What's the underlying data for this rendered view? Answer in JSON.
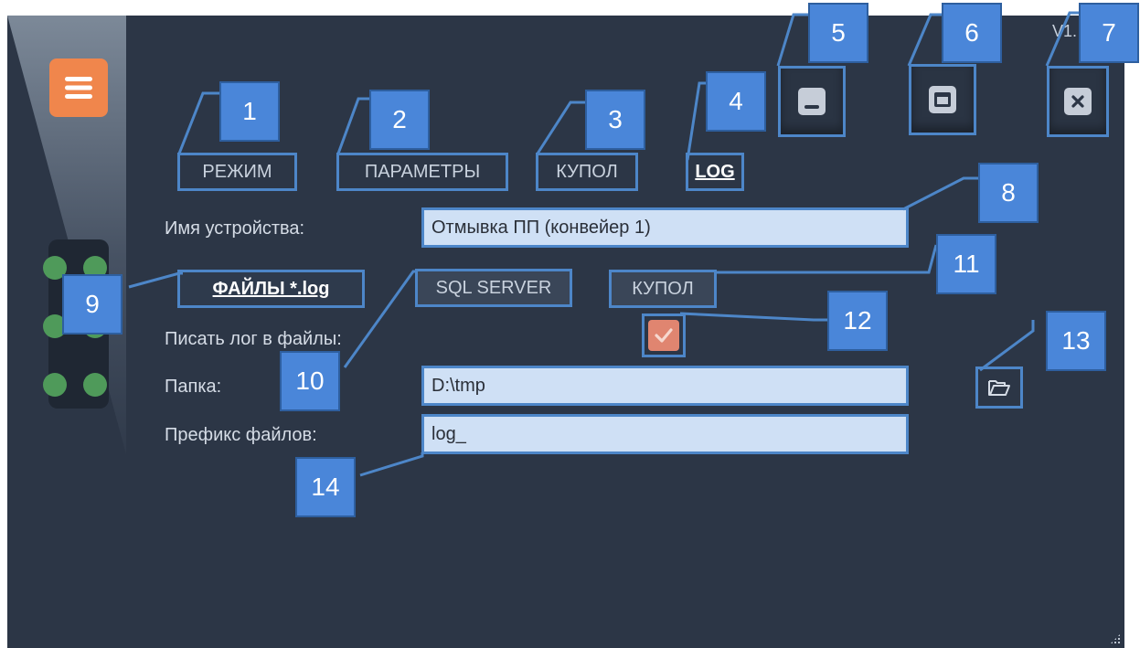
{
  "window": {
    "version_text": "V1."
  },
  "nav": {
    "items": [
      {
        "label": "РЕЖИМ"
      },
      {
        "label": "ПАРАМЕТРЫ"
      },
      {
        "label": "КУПОЛ"
      },
      {
        "label": "LOG"
      }
    ]
  },
  "form": {
    "device_name_label": "Имя устройства:",
    "device_name_value": "Отмывка ПП (конвейер 1)",
    "write_log_label": "Писать лог в файлы:",
    "write_log_checked": true,
    "folder_label": "Папка:",
    "folder_value": "D:\\tmp",
    "prefix_label": "Префикс файлов:",
    "prefix_value": "log_"
  },
  "log_tabs": [
    {
      "label": "ФАЙЛЫ *.log"
    },
    {
      "label": "SQL SERVER"
    },
    {
      "label": "КУПОЛ"
    }
  ],
  "callouts": [
    "1",
    "2",
    "3",
    "4",
    "5",
    "6",
    "7",
    "8",
    "9",
    "10",
    "11",
    "12",
    "13",
    "14"
  ],
  "colors": {
    "background": "#2c3646",
    "accent_orange": "#f0864c",
    "checkbox": "#e08570",
    "indicator_green": "#4f9a5a",
    "annotation_blue": "#4a86d9",
    "field_bg": "#cfe0f5"
  },
  "icons": {
    "menu": "hamburger-icon",
    "minimize": "minimize-icon",
    "maximize": "maximize-icon",
    "close": "close-icon",
    "folder": "folder-open-icon",
    "check": "check-icon"
  }
}
